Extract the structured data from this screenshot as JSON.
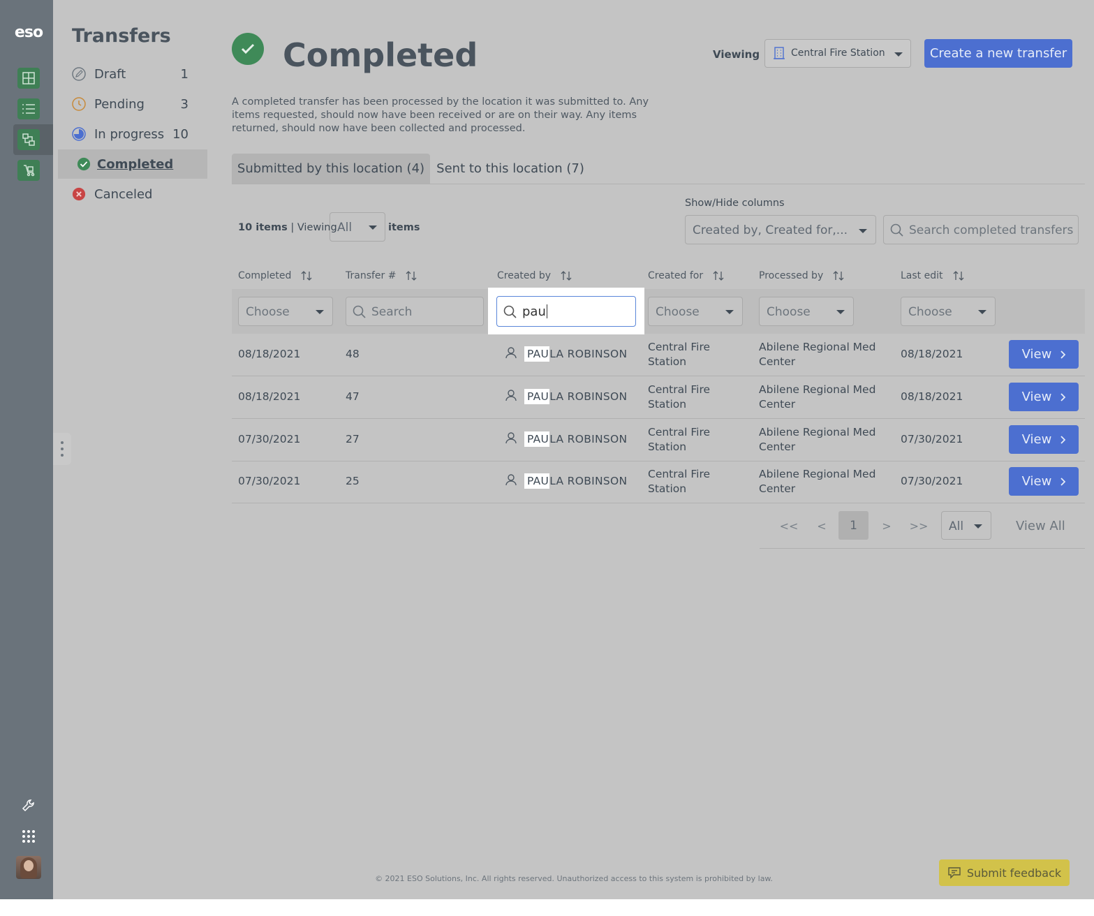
{
  "app": {
    "logo": "eso"
  },
  "rail": {
    "items": [
      "inventory-add-icon",
      "list-icon",
      "transfer-icon",
      "cart-icon"
    ],
    "bottom": [
      "wrench-icon",
      "apps-grid-icon",
      "avatar"
    ]
  },
  "sidebar": {
    "title": "Transfers",
    "items": [
      {
        "label": "Draft",
        "count": "1",
        "icon": "pencil-circle-icon"
      },
      {
        "label": "Pending",
        "count": "3",
        "icon": "clock-icon"
      },
      {
        "label": "In progress",
        "count": "10",
        "icon": "progress-pie-icon"
      },
      {
        "label": "Completed",
        "count": "",
        "icon": "check-circle-icon",
        "active": true
      },
      {
        "label": "Canceled",
        "count": "",
        "icon": "x-circle-icon"
      }
    ]
  },
  "header": {
    "title": "Completed",
    "viewing_label": "Viewing",
    "location": "Central Fire Station",
    "create_button": "Create a new transfer",
    "description": "A completed transfer has been processed by the location it was submitted to. Any items requested, should now have been received or are on their way. Any items returned, should now have been collected and processed."
  },
  "tabs": [
    {
      "label": "Submitted by this location (4)",
      "active": true
    },
    {
      "label": "Sent to this location (7)",
      "active": false
    }
  ],
  "toolbar": {
    "count": "10 items",
    "separator": "|",
    "viewing": "Viewing",
    "page_size": "All",
    "items_word": "items",
    "show_hide_label": "Show/Hide columns",
    "columns_value": "Created by, Created for,...",
    "search_placeholder": "Search completed transfers"
  },
  "table": {
    "headers": [
      "Completed",
      "Transfer #",
      "Created by",
      "Created for",
      "Processed by",
      "Last edit"
    ],
    "filters": {
      "completed": "Choose",
      "transfer": "Search",
      "created_by_value": "pau",
      "created_for": "Choose",
      "processed_by": "Choose",
      "last_edit": "Choose"
    },
    "rows": [
      {
        "completed": "08/18/2021",
        "transfer": "48",
        "name_match": "PAU",
        "name_rest": "LA ROBINSON",
        "created_for_1": "Central Fire",
        "created_for_2": "Station",
        "processed_1": "Abilene Regional Med",
        "processed_2": "Center",
        "last_edit": "08/18/2021",
        "action": "View"
      },
      {
        "completed": "08/18/2021",
        "transfer": "47",
        "name_match": "PAU",
        "name_rest": "LA ROBINSON",
        "created_for_1": "Central Fire",
        "created_for_2": "Station",
        "processed_1": "Abilene Regional Med",
        "processed_2": "Center",
        "last_edit": "08/18/2021",
        "action": "View"
      },
      {
        "completed": "07/30/2021",
        "transfer": "27",
        "name_match": "PAU",
        "name_rest": "LA ROBINSON",
        "created_for_1": "Central Fire",
        "created_for_2": "Station",
        "processed_1": "Abilene Regional Med",
        "processed_2": "Center",
        "last_edit": "07/30/2021",
        "action": "View"
      },
      {
        "completed": "07/30/2021",
        "transfer": "25",
        "name_match": "PAU",
        "name_rest": "LA ROBINSON",
        "created_for_1": "Central Fire",
        "created_for_2": "Station",
        "processed_1": "Abilene Regional Med",
        "processed_2": "Center",
        "last_edit": "07/30/2021",
        "action": "View"
      }
    ]
  },
  "pager": {
    "first": "<<",
    "prev": "<",
    "current": "1",
    "next": ">",
    "last": ">>",
    "size": "All",
    "view_all": "View All"
  },
  "footer": {
    "copyright": "© 2021 ESO Solutions, Inc. All rights reserved. Unauthorized access to this system is prohibited by law.",
    "feedback": "Submit feedback"
  },
  "colors": {
    "accent": "#4c6fd0",
    "success": "#3f8a58",
    "danger": "#c84545",
    "feedback": "#d2c24a"
  }
}
